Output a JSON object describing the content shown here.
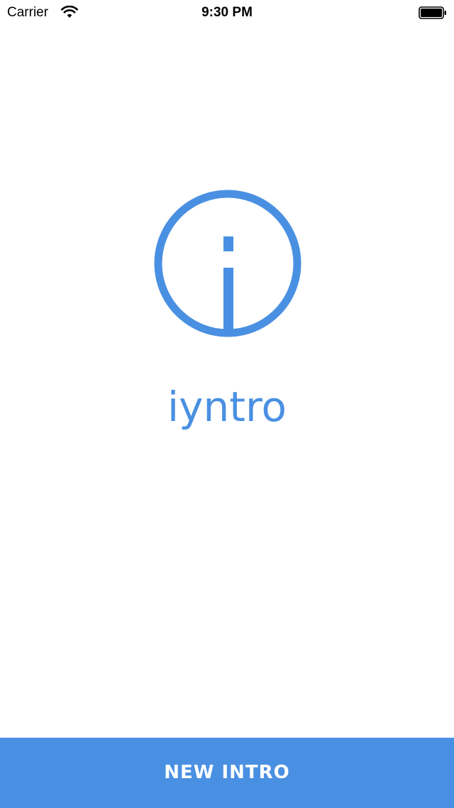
{
  "status_bar": {
    "carrier": "Carrier",
    "time": "9:30 PM",
    "wifi_icon": "wifi-icon",
    "battery_icon": "battery-icon"
  },
  "logo": {
    "icon": "info-circle-icon",
    "color": "#4a90e2"
  },
  "app_name": "iyntro",
  "primary_button": {
    "label": "NEW INTRO",
    "background": "#4a90e2",
    "text_color": "#ffffff"
  }
}
